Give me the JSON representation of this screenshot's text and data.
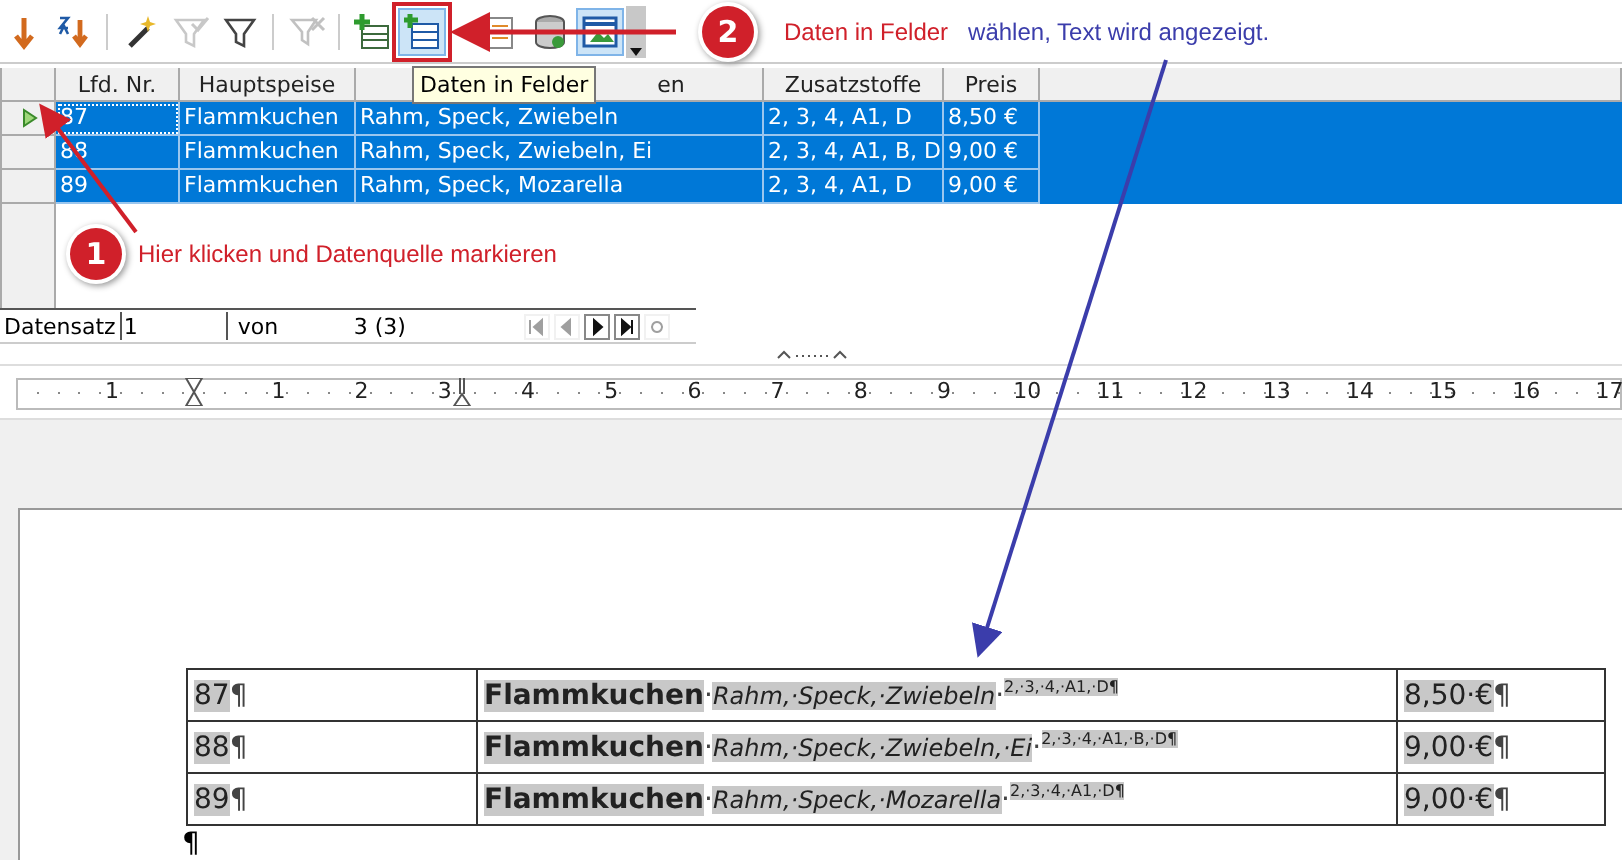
{
  "toolbar": {
    "buttons": [
      {
        "kind": "sort-down",
        "disabled": false,
        "selected": false
      },
      {
        "kind": "sort-za",
        "disabled": false,
        "selected": false
      },
      {
        "kind": "separator"
      },
      {
        "kind": "wand",
        "disabled": false,
        "selected": false
      },
      {
        "kind": "filter-check",
        "disabled": true,
        "selected": false
      },
      {
        "kind": "filter",
        "disabled": false,
        "selected": false
      },
      {
        "kind": "separator"
      },
      {
        "kind": "filter-remove",
        "disabled": true,
        "selected": false
      },
      {
        "kind": "separator"
      },
      {
        "kind": "table-add",
        "disabled": false,
        "selected": false
      },
      {
        "kind": "table-fields",
        "disabled": false,
        "selected": true
      },
      {
        "kind": "document",
        "disabled": false,
        "selected": false
      },
      {
        "kind": "database",
        "disabled": false,
        "selected": false
      },
      {
        "kind": "window",
        "disabled": false,
        "selected": true
      },
      {
        "kind": "dropdown"
      }
    ],
    "tooltip": "Daten in Felder"
  },
  "callouts": [
    {
      "number": "2",
      "text": "Daten in Felder",
      "note": "wählen, Text wird angezeigt."
    },
    {
      "number": "1",
      "text": "Hier klicken und Datenquelle markieren"
    }
  ],
  "data_grid": {
    "columns": [
      "Lfd. Nr.",
      "Hauptspeise",
      "en",
      "Zusatzstoffe",
      "Preis"
    ],
    "rows": [
      {
        "cells": [
          "87",
          "Flammkuchen",
          "Rahm, Speck, Zwiebeln",
          "2, 3, 4, A1, D",
          "8,50 €"
        ],
        "selected": true,
        "current": true
      },
      {
        "cells": [
          "88",
          "Flammkuchen",
          "Rahm, Speck, Zwiebeln, Ei",
          "2, 3, 4, A1, B, D",
          "9,00 €"
        ],
        "selected": true,
        "current": false
      },
      {
        "cells": [
          "89",
          "Flammkuchen",
          "Rahm, Speck, Mozarella",
          "2, 3, 4, A1, D",
          "9,00 €"
        ],
        "selected": true,
        "current": false
      }
    ]
  },
  "navigator": {
    "label": "Datensatz",
    "record": "1",
    "of_label": "von",
    "count": "3 (3)",
    "buttons": [
      {
        "kind": "first",
        "disabled": true
      },
      {
        "kind": "previous",
        "disabled": true
      },
      {
        "kind": "next",
        "disabled": false
      },
      {
        "kind": "last",
        "disabled": false
      },
      {
        "kind": "new",
        "disabled": true
      }
    ]
  },
  "ruler": {
    "labels": [
      "1",
      "1",
      "2",
      "3",
      "4",
      "5",
      "6",
      "7",
      "8",
      "9",
      "10",
      "11",
      "12",
      "13",
      "14",
      "15",
      "16",
      "17"
    ]
  },
  "document_table": {
    "rows": [
      {
        "cells": [
          [
            {
              "text": "87",
              "kind": "field"
            },
            {
              "text": "¶",
              "kind": "mark"
            }
          ],
          [
            {
              "text": "Flammkuchen",
              "kind": "bold-field"
            },
            {
              "text": "·",
              "kind": "mark"
            },
            {
              "text": "Rahm,·Speck,·Zwiebeln",
              "kind": "italic-field"
            },
            {
              "text": "·",
              "kind": "mark"
            },
            {
              "text": "2,·3,·4,·A1,·D¶",
              "kind": "sup-field"
            }
          ],
          [
            {
              "text": "8,50·€",
              "kind": "field"
            },
            {
              "text": "¶",
              "kind": "mark"
            }
          ]
        ]
      },
      {
        "cells": [
          [
            {
              "text": "88",
              "kind": "field"
            },
            {
              "text": "¶",
              "kind": "mark"
            }
          ],
          [
            {
              "text": "Flammkuchen",
              "kind": "bold-field"
            },
            {
              "text": "·",
              "kind": "mark"
            },
            {
              "text": "Rahm,·Speck,·Zwiebeln,·Ei",
              "kind": "italic-field"
            },
            {
              "text": "·",
              "kind": "mark"
            },
            {
              "text": "2,·3,·4,·A1,·B,·D¶",
              "kind": "sup-field"
            }
          ],
          [
            {
              "text": "9,00·€",
              "kind": "field"
            },
            {
              "text": "¶",
              "kind": "mark"
            }
          ]
        ]
      },
      {
        "cells": [
          [
            {
              "text": "89",
              "kind": "field"
            },
            {
              "text": "¶",
              "kind": "mark"
            }
          ],
          [
            {
              "text": "Flammkuchen",
              "kind": "bold-field"
            },
            {
              "text": "·",
              "kind": "mark"
            },
            {
              "text": "Rahm,·Speck,·Mozarella",
              "kind": "italic-field"
            },
            {
              "text": "·",
              "kind": "mark"
            },
            {
              "text": "2,·3,·4,·A1,·D¶",
              "kind": "sup-field"
            }
          ],
          [
            {
              "text": "9,00·€",
              "kind": "field"
            },
            {
              "text": "¶",
              "kind": "mark"
            }
          ]
        ]
      }
    ],
    "after": "¶"
  }
}
